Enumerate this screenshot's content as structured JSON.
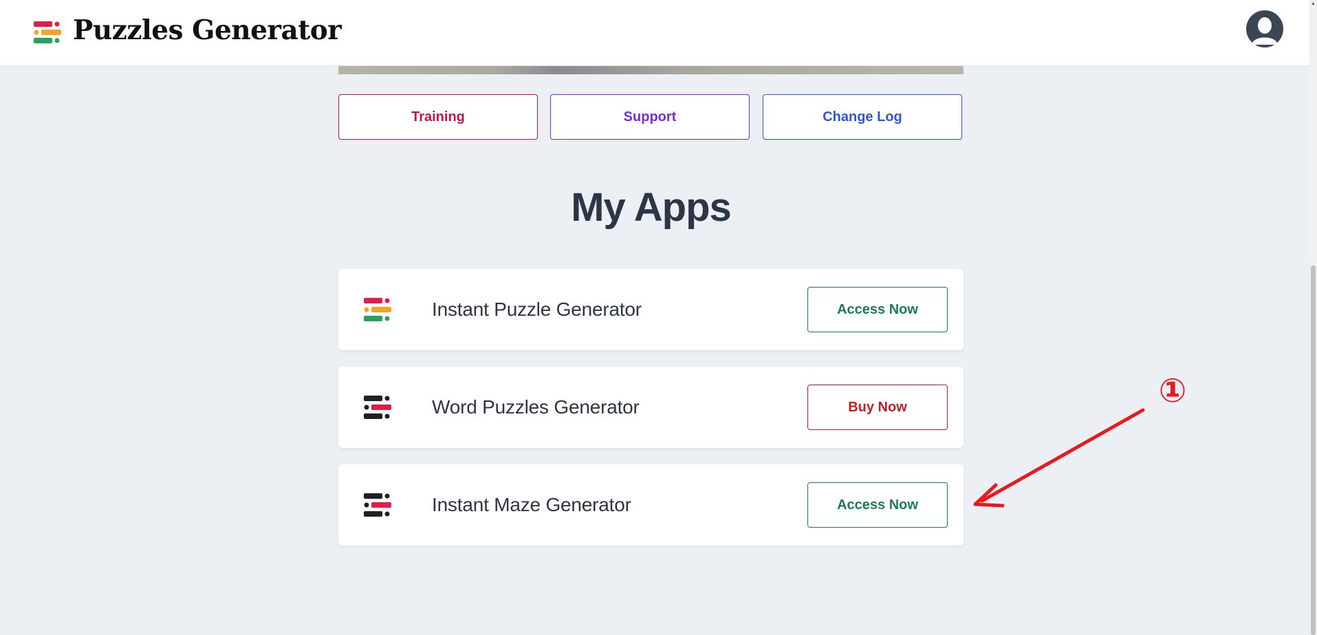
{
  "header": {
    "brand": "Puzzles Generator",
    "logo_icon": "puzzle-bars-icon",
    "avatar_icon": "user-avatar-icon"
  },
  "quick_links": [
    {
      "label": "Training",
      "color": "#c01845"
    },
    {
      "label": "Support",
      "color": "#7a2be0"
    },
    {
      "label": "Change Log",
      "color": "#2f56d9"
    }
  ],
  "main": {
    "title": "My Apps",
    "apps": [
      {
        "name": "Instant Puzzle Generator",
        "button_label": "Access Now",
        "button_color": "#1f7a56",
        "icon": "puzzle-bars-color-icon"
      },
      {
        "name": "Word Puzzles Generator",
        "button_label": "Buy Now",
        "button_color": "#c02020",
        "icon": "puzzle-bars-dark-icon"
      },
      {
        "name": "Instant Maze Generator",
        "button_label": "Access Now",
        "button_color": "#1f7a56",
        "icon": "puzzle-bars-dark-icon"
      }
    ]
  },
  "annotation": {
    "marker": "①",
    "color": "#e8191f"
  }
}
